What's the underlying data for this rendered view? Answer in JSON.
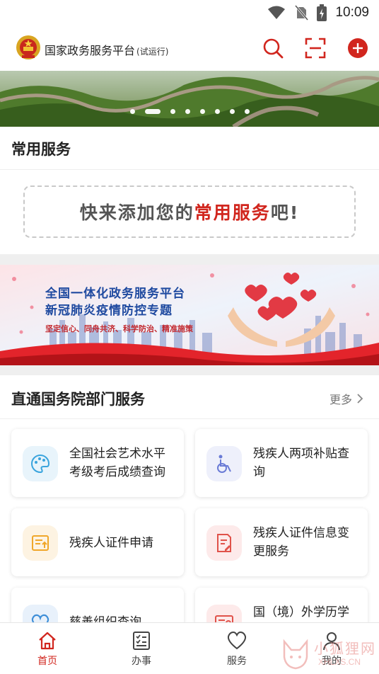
{
  "status_bar": {
    "time": "10:09",
    "icons": [
      "wifi-icon",
      "no-sim-icon",
      "battery-charging-icon"
    ]
  },
  "header": {
    "title": "国家政务服务平台",
    "title_suffix": "(试运行)",
    "logo_icon": "national-emblem-icon",
    "actions": [
      "search-icon",
      "scan-icon",
      "add-circle-icon"
    ],
    "accent_color": "#d1261e"
  },
  "banner": {
    "image": "great-wall-landscape",
    "slide_count": 8,
    "active_slide": 2
  },
  "common_services": {
    "title": "常用服务",
    "placeholder_prefix": "快来添加您的",
    "placeholder_highlight": "常用服务",
    "placeholder_suffix": "吧!"
  },
  "promo": {
    "line1": "全国一体化政务服务平台",
    "line2": "新冠肺炎疫情防控专题",
    "slogan": "坚定信心、同舟共济、科学防治、精准施策"
  },
  "departments": {
    "title": "直通国务院部门服务",
    "more_label": "更多",
    "items": [
      {
        "label": "全国社会艺术水平考级考后成绩查询",
        "icon": "palette-icon",
        "icon_bg": "#e8f4fb",
        "icon_color": "#3aa4dd"
      },
      {
        "label": "残疾人两项补贴查询",
        "icon": "wheelchair-icon",
        "icon_bg": "#eef0fb",
        "icon_color": "#6a7bd6"
      },
      {
        "label": "残疾人证件申请",
        "icon": "document-upload-icon",
        "icon_bg": "#fdf3e2",
        "icon_color": "#f0a72a"
      },
      {
        "label": "残疾人证件信息变更服务",
        "icon": "document-edit-icon",
        "icon_bg": "#fdeaea",
        "icon_color": "#e0524a"
      },
      {
        "label": "慈善组织查询",
        "icon": "heart-hands-icon",
        "icon_bg": "#e8f1fb",
        "icon_color": "#3f8fd8"
      },
      {
        "label": "国（境）外学历学",
        "icon": "certificate-icon",
        "icon_bg": "#fdeaea",
        "icon_color": "#e0524a"
      }
    ]
  },
  "tabbar": {
    "tabs": [
      {
        "label": "首页",
        "icon": "home-icon",
        "active": true
      },
      {
        "label": "办事",
        "icon": "checklist-icon",
        "active": false
      },
      {
        "label": "服务",
        "icon": "heart-icon",
        "active": false
      },
      {
        "label": "我的",
        "icon": "person-icon",
        "active": false
      }
    ]
  },
  "watermark": {
    "text": "小狐狸网",
    "sub": "XHLXS.CN"
  }
}
